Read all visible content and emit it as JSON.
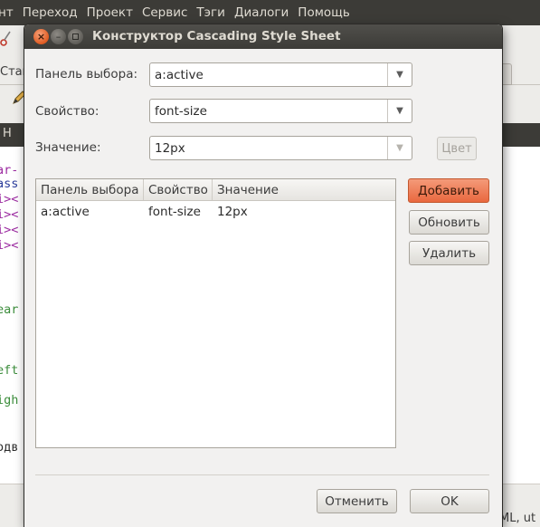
{
  "app": {
    "menu": [
      "нт",
      "Переход",
      "Проект",
      "Сервис",
      "Тэги",
      "Диалоги",
      "Помощь"
    ],
    "tab_left_label": "Стан",
    "darkbar_label": "Н",
    "status_text": "ML, ut",
    "editor_lines": [
      {
        "text": "ar-",
        "color": "#9b2aa0"
      },
      {
        "text": "ass",
        "color": "#2a3c9b"
      },
      {
        "text": "i><",
        "color": "#9b2aa0"
      },
      {
        "text": "i><",
        "color": "#9b2aa0"
      },
      {
        "text": "i><",
        "color": "#9b2aa0"
      },
      {
        "text": "i><",
        "color": "#9b2aa0"
      },
      {
        "text": "ear",
        "color": "#3c8d3c"
      },
      {
        "text": "eft",
        "color": "#3c8d3c"
      },
      {
        "text": "igh",
        "color": "#3c8d3c"
      },
      {
        "text": "одв",
        "color": "#2c2c2c"
      }
    ]
  },
  "dialog": {
    "title": "Конструктор Cascading Style Sheet",
    "fields": {
      "selector_label": "Панель выбора:",
      "selector_value": "a:active",
      "property_label": "Свойство:",
      "property_value": "font-size",
      "value_label": "Значение:",
      "value_value": "12px",
      "color_button": "Цвет"
    },
    "table": {
      "columns": [
        "Панель выбора",
        "Свойство",
        "Значение"
      ],
      "rows": [
        [
          "a:active",
          "font-size",
          "12px"
        ]
      ]
    },
    "buttons": {
      "add": "Добавить",
      "update": "Обновить",
      "delete": "Удалить",
      "cancel": "Отменить",
      "ok": "OK"
    }
  }
}
